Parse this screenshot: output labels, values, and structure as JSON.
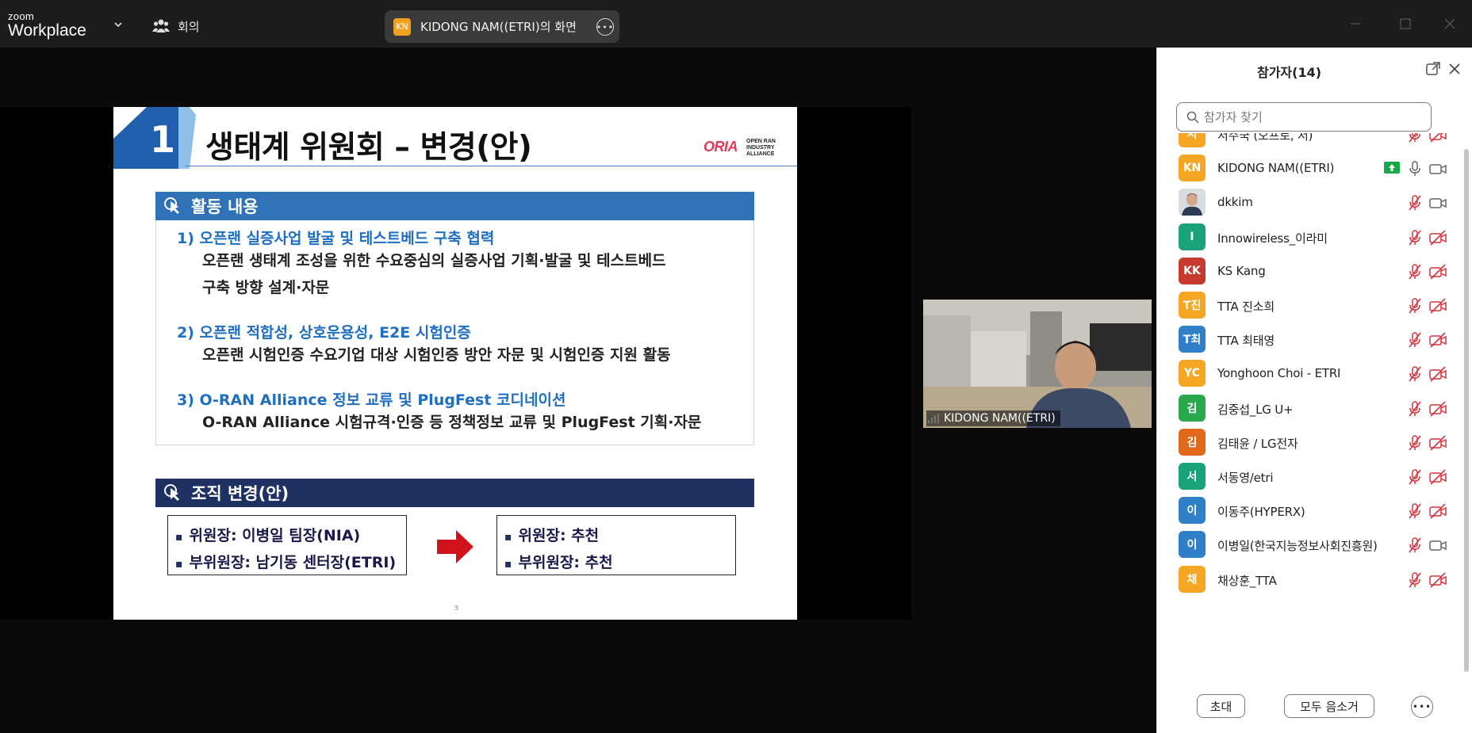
{
  "topbar": {
    "brand_small": "zoom",
    "brand_large": "Workplace",
    "meeting_label": "회의",
    "share_badge": "KN",
    "share_title": "KIDONG NAM((ETRI)의 화면"
  },
  "slide": {
    "number": "1",
    "title": "생태계 위원회 – 변경(안)",
    "logo_text": "ORIA",
    "logo_small": [
      "OPEN RAN",
      "INDUSTRY",
      "ALLIANCE"
    ],
    "section1_title": "활동 내용",
    "items": [
      {
        "head": "1)   오픈랜 실증사업 발굴 및 테스트베드 구축 협력",
        "body": [
          "오픈랜 생태계 조성을 위한 수요중심의 실증사업 기획·발굴 및 테스트베드",
          "구축 방향 설계·자문"
        ]
      },
      {
        "head": "2)   오픈랜 적합성, 상호운용성, E2E 시험인증",
        "body": [
          "오픈랜 시험인증 수요기업 대상 시험인증 방안 자문 및 시험인증 지원 활동"
        ]
      },
      {
        "head": "3)   O-RAN Alliance 정보 교류 및 PlugFest 코디네이션",
        "body": [
          "O-RAN Alliance 시험규격·인증 등 정책정보 교류 및 PlugFest 기획·자문"
        ]
      }
    ],
    "section2_title": "조직 변경(안)",
    "before": [
      "위원장: 이병일 팀장(NIA)",
      "부위원장: 남기동 센터장(ETRI)"
    ],
    "after": [
      "위원장: 추천",
      "부위원장: 추천"
    ],
    "page_number": "3"
  },
  "video": {
    "name": "KIDONG NAM((ETRI)"
  },
  "panel": {
    "title": "참가자(14)",
    "search_placeholder": "참가자 찾기",
    "participants": [
      {
        "initials": "서",
        "name": "서주국 (오프로, 서)",
        "color": "#f5a623",
        "mic": "muted",
        "cam": "off",
        "share": false
      },
      {
        "initials": "KN",
        "name": "KIDONG NAM((ETRI)",
        "color": "#f5a623",
        "mic": "on",
        "cam": "on",
        "share": true
      },
      {
        "initials": "",
        "name": "dkkim",
        "color": "#9aa4b0",
        "mic": "muted",
        "cam": "on",
        "share": false,
        "photo": true
      },
      {
        "initials": "I",
        "name": "Innowireless_이라미",
        "color": "#1aa37a",
        "mic": "muted",
        "cam": "off",
        "share": false
      },
      {
        "initials": "KK",
        "name": "KS Kang",
        "color": "#c63b2e",
        "mic": "muted",
        "cam": "off",
        "share": false
      },
      {
        "initials": "T진",
        "name": "TTA 진소희",
        "color": "#f5a623",
        "mic": "muted",
        "cam": "off",
        "share": false
      },
      {
        "initials": "T최",
        "name": "TTA 최태영",
        "color": "#2f80c8",
        "mic": "muted",
        "cam": "off",
        "share": false
      },
      {
        "initials": "YC",
        "name": "Yonghoon Choi - ETRI",
        "color": "#f5a623",
        "mic": "muted",
        "cam": "off",
        "share": false
      },
      {
        "initials": "김",
        "name": "김중섭_LG U+",
        "color": "#2aa84e",
        "mic": "muted",
        "cam": "off",
        "share": false
      },
      {
        "initials": "김",
        "name": "김태윤 / LG전자",
        "color": "#e0691a",
        "mic": "muted",
        "cam": "off",
        "share": false
      },
      {
        "initials": "서",
        "name": "서동영/etri",
        "color": "#1aa37a",
        "mic": "muted",
        "cam": "off",
        "share": false
      },
      {
        "initials": "이",
        "name": "이동주(HYPERX)",
        "color": "#2f80c8",
        "mic": "muted",
        "cam": "off",
        "share": false
      },
      {
        "initials": "이",
        "name": "이병일(한국지능정보사회진흥원)",
        "color": "#2f80c8",
        "mic": "muted",
        "cam": "on",
        "share": false
      },
      {
        "initials": "채",
        "name": "채상훈_TTA",
        "color": "#f5a623",
        "mic": "muted",
        "cam": "off",
        "share": false
      }
    ],
    "invite_label": "초대",
    "mute_all_label": "모두 음소거"
  }
}
